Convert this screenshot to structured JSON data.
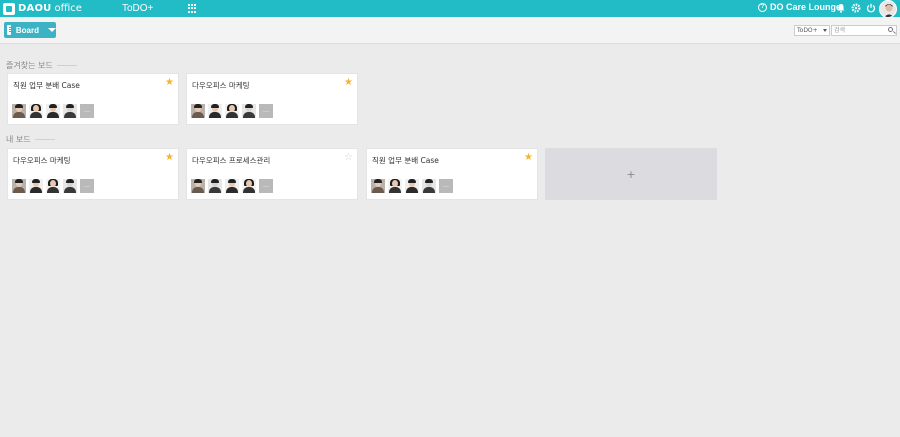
{
  "header": {
    "logo_text": "DAOU",
    "logo_sub": "office",
    "app_title": "ToDO+",
    "lounge_label": "DO Care Lounge",
    "icons": [
      "apps-grid-icon",
      "help-icon",
      "bell-icon",
      "gear-icon",
      "power-icon"
    ],
    "accent_color": "#22bcc7"
  },
  "toolbar": {
    "board_label": "Board",
    "search_scope": "ToDO+",
    "search_placeholder": "검색"
  },
  "favorites": {
    "title": "즐겨찾는 보드",
    "cards": [
      {
        "title": "직원 업무 분배 Case",
        "starred": true
      },
      {
        "title": "다우오피스 마케팅",
        "starred": true
      }
    ]
  },
  "my_boards": {
    "title": "내 보드",
    "cards": [
      {
        "title": "다우오피스 마케팅",
        "starred": true
      },
      {
        "title": "다우오피스 프로세스관리",
        "starred": false
      },
      {
        "title": "직원 업무 분배 Case",
        "starred": true
      }
    ],
    "add_label": "+"
  },
  "member_more_label": "…",
  "star_color": "#f3b530"
}
